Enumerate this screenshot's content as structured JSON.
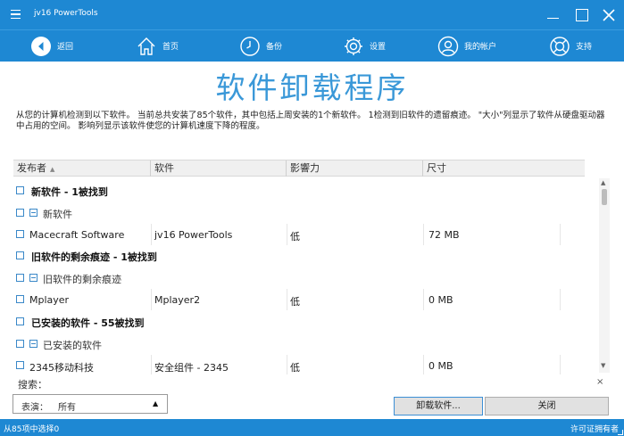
{
  "app": {
    "title": "jv16 PowerTools"
  },
  "nav": {
    "back": "返回",
    "home": "首页",
    "backup": "备份",
    "settings": "设置",
    "account": "我的帐户",
    "support": "支持"
  },
  "heading": "软件卸载程序",
  "description": "从您的计算机检测到以下软件。 当前总共安装了85个软件，其中包括上周安装的1个新软件。 1检测到旧软件的遗留痕迹。 \"大小\"列显示了软件从硬盘驱动器中占用的空间。 影响列显示该软件使您的计算机速度下降的程度。",
  "table": {
    "columns": {
      "publisher": "发布者",
      "software": "软件",
      "impact": "影響力",
      "size": "尺寸"
    },
    "groups": [
      {
        "title": "新软件 - 1被找到",
        "subtitle": "新软件",
        "row": {
          "publisher": "Macecraft Software",
          "software": "jv16 PowerTools",
          "impact": "低",
          "size": "72 MB"
        }
      },
      {
        "title": "旧软件的剩余痕迹 - 1被找到",
        "subtitle": "旧软件的剩余痕迹",
        "row": {
          "publisher": "Mplayer",
          "software": "Mplayer2",
          "impact": "低",
          "size": "0 MB"
        }
      },
      {
        "title": "已安装的软件 - 55被找到",
        "subtitle": "已安装的软件",
        "row": {
          "publisher": "2345移动科技",
          "software": "安全组件 - 2345",
          "impact": "低",
          "size": "0 MB"
        }
      }
    ]
  },
  "search": {
    "label": "搜索：",
    "clear": "×"
  },
  "filter": {
    "label": "表演：",
    "value": "所有"
  },
  "buttons": {
    "uninstall": "卸载软件...",
    "close": "关闭"
  },
  "status": {
    "left": "从85项中选择0",
    "right": "许可证拥有者"
  },
  "colors": {
    "accent": "#1e88d3",
    "heading": "#3a98d8"
  }
}
